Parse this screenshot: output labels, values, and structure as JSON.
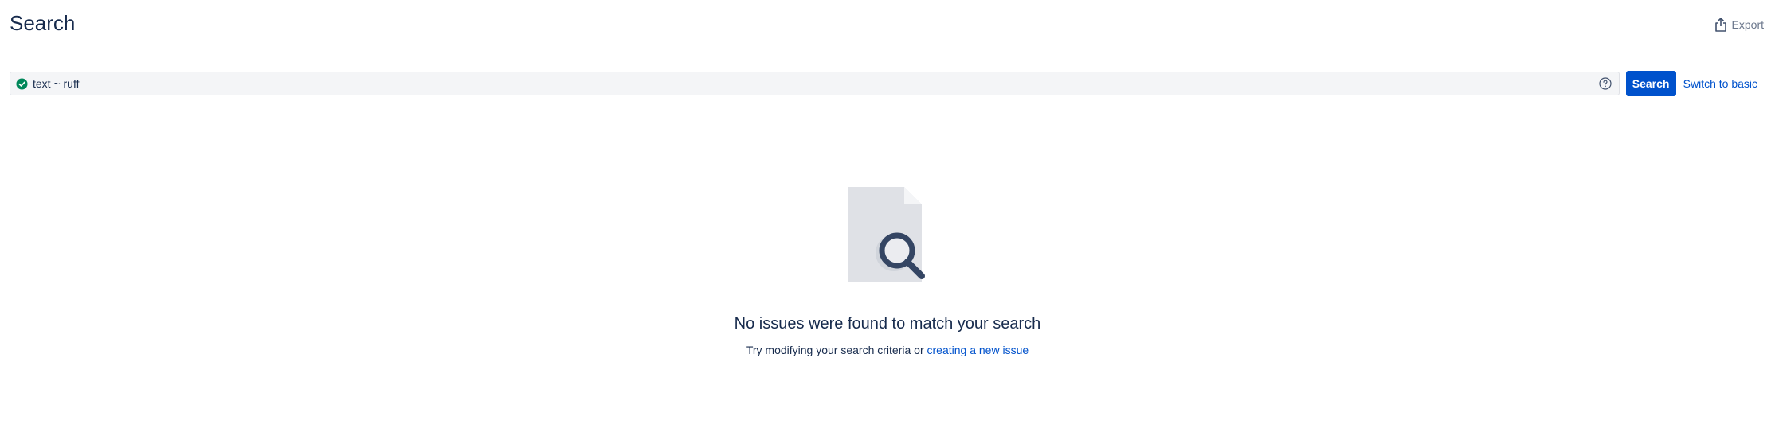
{
  "header": {
    "title": "Search",
    "export_label": "Export",
    "export_icon": "share-export-icon"
  },
  "search": {
    "query_value": "text ~ ruff",
    "valid_icon": "check-circle-icon",
    "help_icon": "question-circle-icon",
    "search_button_label": "Search",
    "switch_label": "Switch to basic"
  },
  "empty_state": {
    "illustration": "document-magnifier-icon",
    "title": "No issues were found to match your search",
    "description_prefix": "Try modifying your search criteria or",
    "create_link_label": "creating a new issue"
  },
  "colors": {
    "primary": "#0052CC",
    "valid": "#00875A",
    "text": "#172B4D",
    "subtle": "#6B778C",
    "input_bg": "#F4F5F7"
  }
}
